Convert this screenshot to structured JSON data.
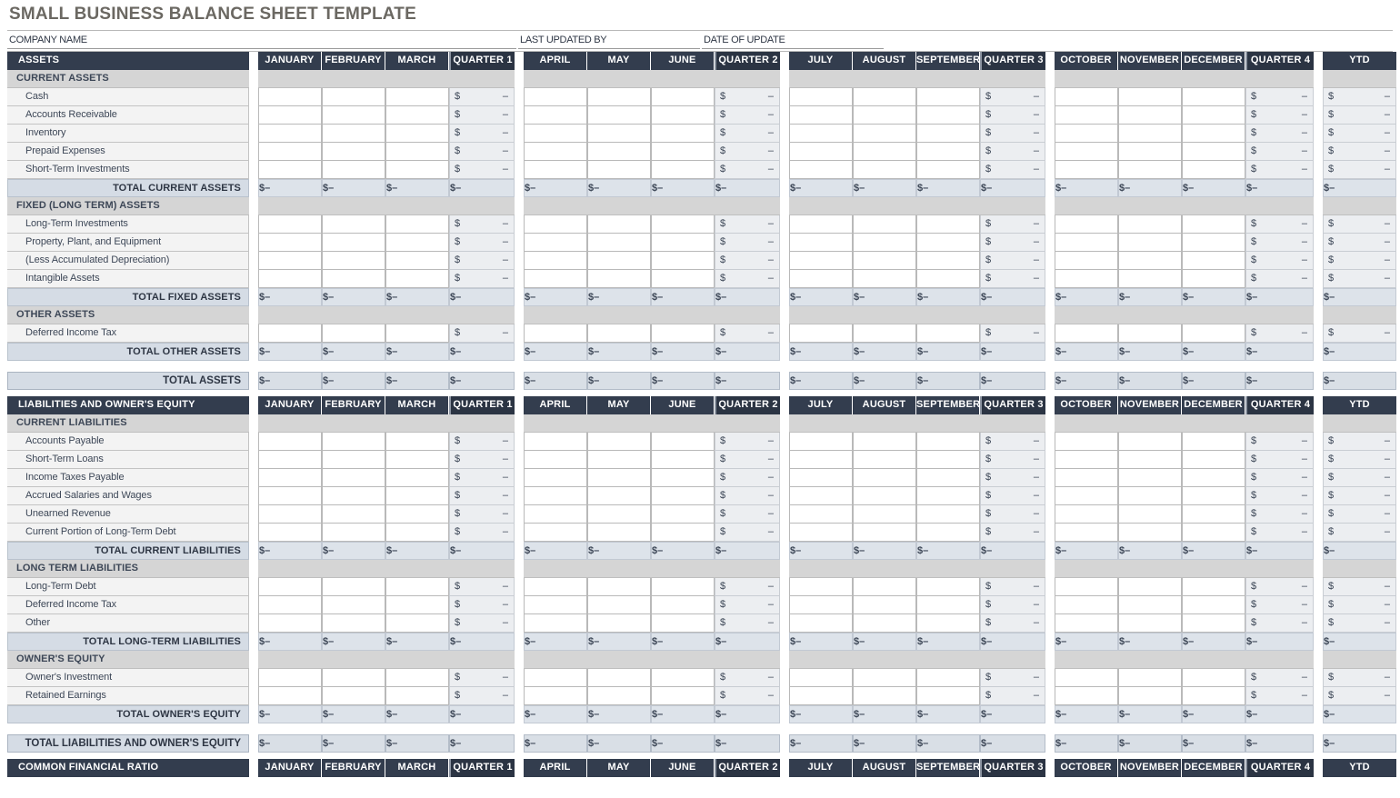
{
  "title": "SMALL BUSINESS BALANCE SHEET TEMPLATE",
  "meta": {
    "company_label": "COMPANY NAME",
    "company_value": "",
    "updated_by_label": "LAST UPDATED BY",
    "updated_by_value": "",
    "date_label": "DATE OF UPDATE",
    "date_value": ""
  },
  "colors": {
    "header_dark": "#333d4e",
    "quarter_dark": "#2b3443",
    "section_gray": "#d5d5d5",
    "total_blue": "#d5dce5",
    "calc_gray": "#eceef1",
    "title_text": "#6b6862"
  },
  "column_headers": {
    "q1": [
      "JANUARY",
      "FEBRUARY",
      "MARCH",
      "QUARTER 1"
    ],
    "q2": [
      "APRIL",
      "MAY",
      "JUNE",
      "QUARTER 2"
    ],
    "q3": [
      "JULY",
      "AUGUST",
      "SEPTEMBER",
      "QUARTER 3"
    ],
    "q4": [
      "OCTOBER",
      "NOVEMBER",
      "DECEMBER",
      "QUARTER 4"
    ],
    "ytd": "YTD"
  },
  "value_placeholder": {
    "currency": "$",
    "dash": "–"
  },
  "assets": {
    "header": "ASSETS",
    "groups": [
      {
        "name": "CURRENT ASSETS",
        "items": [
          "Cash",
          "Accounts Receivable",
          "Inventory",
          "Prepaid Expenses",
          "Short-Term Investments"
        ],
        "total": "TOTAL CURRENT ASSETS"
      },
      {
        "name": "FIXED (LONG TERM) ASSETS",
        "items": [
          "Long-Term Investments",
          "Property, Plant, and Equipment",
          "(Less Accumulated Depreciation)",
          "Intangible Assets"
        ],
        "total": "TOTAL FIXED ASSETS"
      },
      {
        "name": "OTHER ASSETS",
        "items": [
          "Deferred Income Tax"
        ],
        "total": "TOTAL OTHER ASSETS"
      }
    ],
    "grand_total": "TOTAL ASSETS"
  },
  "liabilities": {
    "header": "LIABILITIES AND OWNER'S EQUITY",
    "groups": [
      {
        "name": "CURRENT LIABILITIES",
        "items": [
          "Accounts Payable",
          "Short-Term Loans",
          "Income Taxes Payable",
          "Accrued Salaries and Wages",
          "Unearned Revenue",
          "Current Portion of Long-Term Debt"
        ],
        "total": "TOTAL CURRENT LIABILITIES"
      },
      {
        "name": "LONG TERM LIABILITIES",
        "items": [
          "Long-Term Debt",
          "Deferred Income Tax",
          "Other"
        ],
        "total": "TOTAL LONG-TERM LIABILITIES"
      },
      {
        "name": "OWNER'S EQUITY",
        "items": [
          "Owner's Investment",
          "Retained Earnings"
        ],
        "total": "TOTAL OWNER'S EQUITY"
      }
    ],
    "grand_total": "TOTAL LIABILITIES AND OWNER'S EQUITY"
  },
  "ratio": {
    "header": "COMMON FINANCIAL RATIO"
  }
}
